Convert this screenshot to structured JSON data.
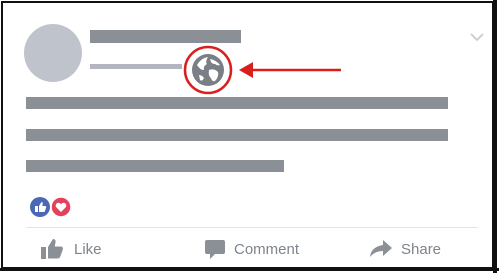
{
  "post": {
    "audience_icon": "globe-icon",
    "menu_icon": "chevron-down-icon",
    "annotation": {
      "type": "arrow",
      "color": "#d91e1e"
    }
  },
  "reactions": [
    {
      "type": "like",
      "color": "#4a68b3"
    },
    {
      "type": "love",
      "color": "#e4415d"
    }
  ],
  "actions": [
    {
      "id": "like",
      "label": "Like",
      "icon": "thumbs-up-icon"
    },
    {
      "id": "comment",
      "label": "Comment",
      "icon": "speech-bubble-icon"
    },
    {
      "id": "share",
      "label": "Share",
      "icon": "share-arrow-icon"
    }
  ],
  "colors": {
    "placeholder_dark": "#8b8f96",
    "placeholder_light": "#b2b6bf",
    "avatar": "#bfc3cc",
    "action_text": "#7f838c"
  }
}
